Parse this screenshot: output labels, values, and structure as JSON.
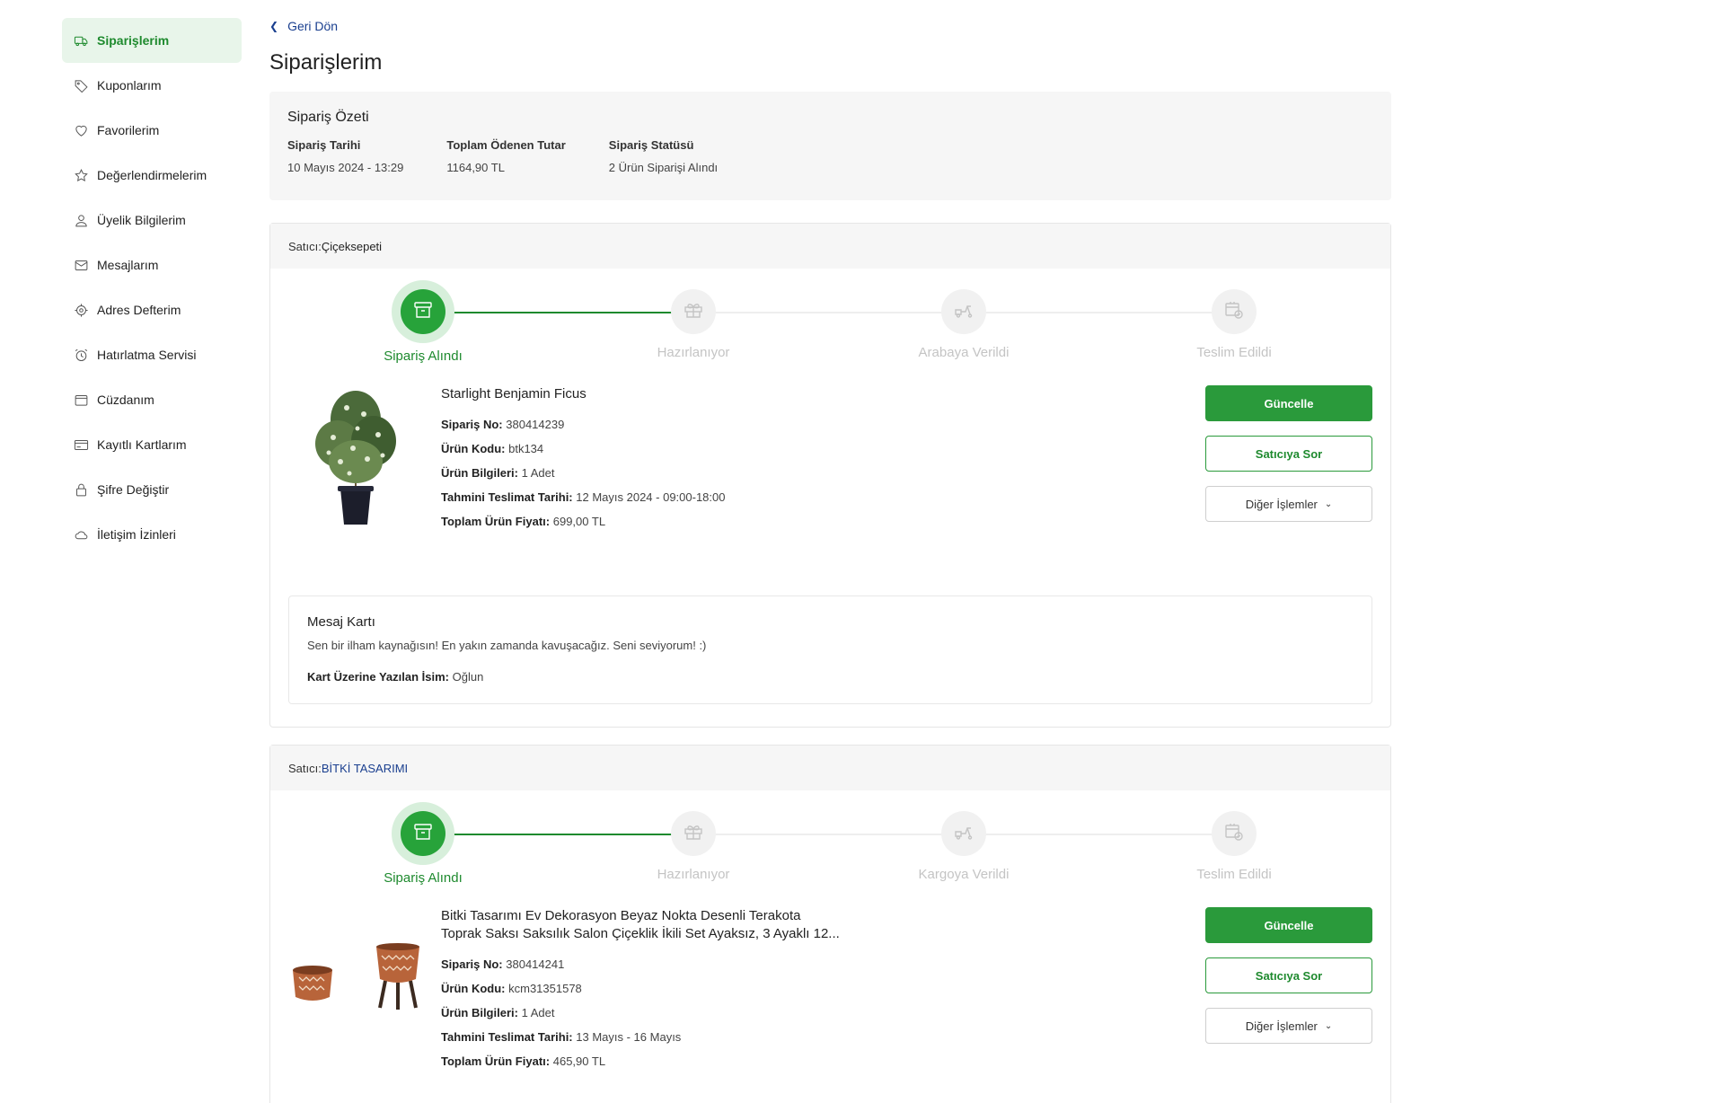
{
  "sidebar": {
    "items": [
      {
        "label": "Siparişlerim",
        "icon": "truck-icon",
        "active": true
      },
      {
        "label": "Kuponlarım",
        "icon": "tag-icon"
      },
      {
        "label": "Favorilerim",
        "icon": "heart-icon"
      },
      {
        "label": "Değerlendirmelerim",
        "icon": "star-icon"
      },
      {
        "label": "Üyelik Bilgilerim",
        "icon": "user-icon"
      },
      {
        "label": "Mesajlarım",
        "icon": "mail-icon"
      },
      {
        "label": "Adres Defterim",
        "icon": "location-icon"
      },
      {
        "label": "Hatırlatma Servisi",
        "icon": "alarm-icon"
      },
      {
        "label": "Cüzdanım",
        "icon": "wallet-icon"
      },
      {
        "label": "Kayıtlı Kartlarım",
        "icon": "card-icon"
      },
      {
        "label": "Şifre Değiştir",
        "icon": "lock-icon"
      },
      {
        "label": "İletişim İzinleri",
        "icon": "cloud-icon"
      }
    ]
  },
  "header": {
    "back_label": "Geri Dön",
    "title": "Siparişlerim"
  },
  "summary": {
    "title": "Sipariş Özeti",
    "date_label": "Sipariş Tarihi",
    "date_value": "10 Mayıs 2024 - 13:29",
    "total_label": "Toplam Ödenen Tutar",
    "total_value": "1164,90 TL",
    "status_label": "Sipariş Statüsü",
    "status_value": "2 Ürün Siparişi Alındı"
  },
  "orders": [
    {
      "seller_prefix": "Satıcı:",
      "seller": "Çiçeksepeti",
      "steps": [
        "Sipariş Alındı",
        "Hazırlanıyor",
        "Arabaya Verildi",
        "Teslim Edildi"
      ],
      "completed_steps": 1,
      "product_name": "Starlight Benjamin Ficus",
      "order_no_label": "Sipariş No:",
      "order_no": "380414239",
      "code_label": "Ürün Kodu:",
      "code": "btk134",
      "info_label": "Ürün Bilgileri:",
      "info": "1 Adet",
      "delivery_label": "Tahmini Teslimat Tarihi:",
      "delivery": "12 Mayıs 2024 - 09:00-18:00",
      "price_label": "Toplam Ürün Fiyatı:",
      "price": "699,00 TL",
      "btn_update": "Güncelle",
      "btn_ask": "Satıcıya Sor",
      "btn_more": "Diğer İşlemler",
      "message": {
        "title": "Mesaj Kartı",
        "text": "Sen bir ilham kaynağısın!   En yakın zamanda kavuşacağız. Seni seviyorum! :)",
        "name_label": "Kart Üzerine Yazılan İsim:",
        "name": "Oğlun"
      }
    },
    {
      "seller_prefix": "Satıcı:",
      "seller": "BİTKİ TASARIMI",
      "steps": [
        "Sipariş Alındı",
        "Hazırlanıyor",
        "Kargoya Verildi",
        "Teslim Edildi"
      ],
      "completed_steps": 1,
      "product_name_line1": "Bitki Tasarımı Ev Dekorasyon Beyaz Nokta Desenli Terakota",
      "product_name_line2": "Toprak Saksı Saksılık Salon Çiçeklik İkili Set Ayaksız, 3 Ayaklı 12...",
      "order_no_label": "Sipariş No:",
      "order_no": "380414241",
      "code_label": "Ürün Kodu:",
      "code": "kcm31351578",
      "info_label": "Ürün Bilgileri:",
      "info": "1 Adet",
      "delivery_label": "Tahmini Teslimat Tarihi:",
      "delivery": "13 Mayıs - 16 Mayıs",
      "price_label": "Toplam Ürün Fiyatı:",
      "price": "465,90 TL",
      "btn_update": "Güncelle",
      "btn_ask": "Satıcıya Sor",
      "btn_more": "Diğer İşlemler"
    }
  ],
  "colors": {
    "accent": "#2a9a3b",
    "accent_light": "#d7efdb",
    "link": "#1a3f8f",
    "panel_bg": "#f6f6f6"
  }
}
